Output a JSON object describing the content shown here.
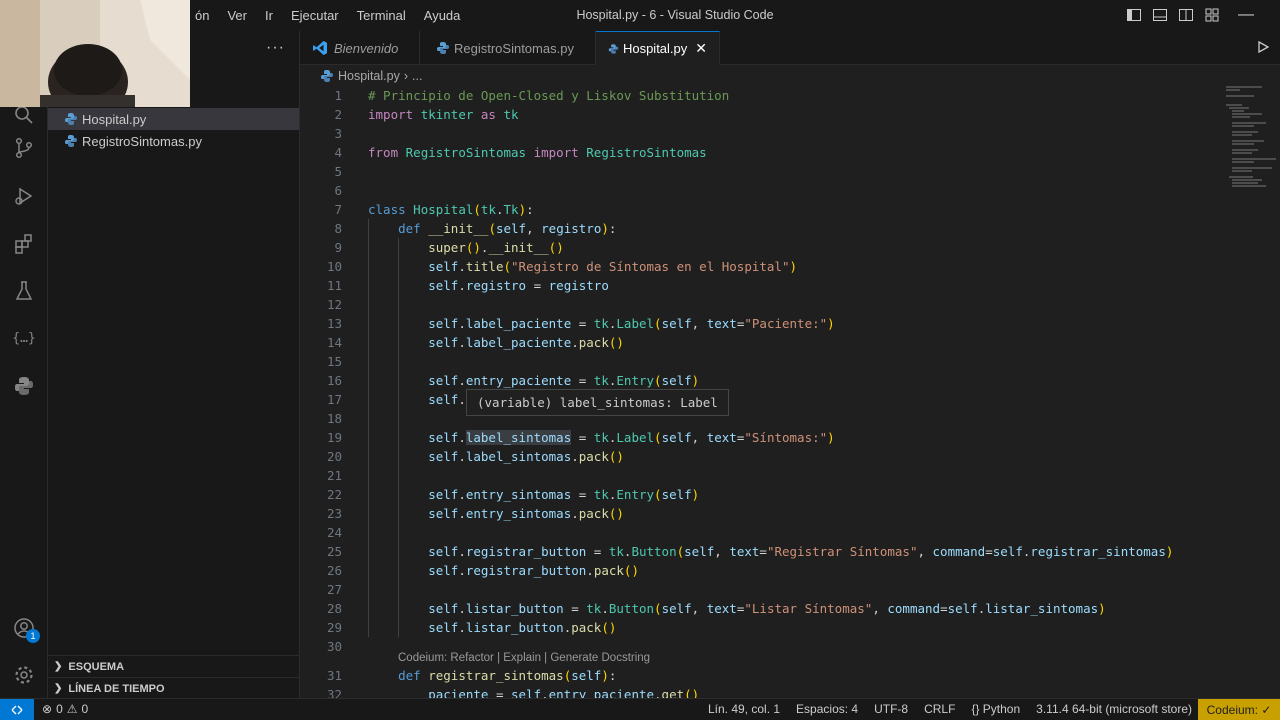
{
  "menu": [
    "ón",
    "Ver",
    "Ir",
    "Ejecutar",
    "Terminal",
    "Ayuda"
  ],
  "window_title": "Hospital.py - 6 - Visual Studio Code",
  "sidebar": {
    "more": "···",
    "files": [
      "Hospital.py",
      "RegistroSintomas.py"
    ],
    "sections": [
      "ESQUEMA",
      "LÍNEA DE TIEMPO"
    ]
  },
  "activity": {
    "accounts_badge": "1"
  },
  "tabs": [
    {
      "label": "Bienvenido"
    },
    {
      "label": "RegistroSintomas.py"
    },
    {
      "label": "Hospital.py",
      "close": "✕"
    }
  ],
  "breadcrumb": {
    "file": "Hospital.py",
    "sep": "›",
    "more": "..."
  },
  "lines": [
    "1",
    "2",
    "3",
    "4",
    "5",
    "6",
    "7",
    "8",
    "9",
    "10",
    "11",
    "12",
    "13",
    "14",
    "15",
    "16",
    "17",
    "18",
    "19",
    "20",
    "21",
    "22",
    "23",
    "24",
    "25",
    "26",
    "27",
    "28",
    "29",
    "30",
    "31",
    "32"
  ],
  "codelens": "Codeium: Refactor | Explain | Generate Docstring",
  "hover": "(variable) label_sintomas: Label",
  "status": {
    "errors": "0",
    "warnings": "0",
    "position": "Lín. 49, col. 1",
    "spaces": "Espacios: 4",
    "encoding": "UTF-8",
    "eol": "CRLF",
    "language": "Python",
    "interpreter": "3.11.4 64-bit (microsoft store)",
    "codeium": "Codeium: ✓"
  },
  "colors": {
    "accent": "#0078d4",
    "codeium": "#c8a100"
  }
}
